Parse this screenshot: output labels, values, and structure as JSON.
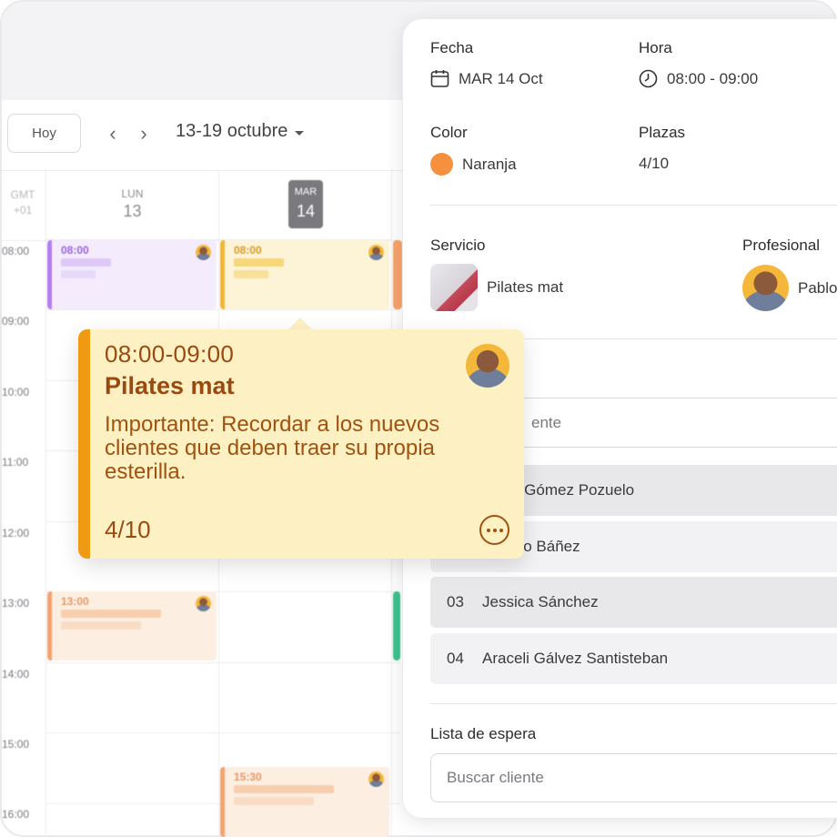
{
  "toolbar": {
    "today_label": "Hoy",
    "prev_icon": "chevron-left-icon",
    "next_icon": "chevron-right-icon",
    "range_label": "13-19 octubre"
  },
  "calendar": {
    "timezone": [
      "GMT",
      "+01"
    ],
    "days": [
      {
        "name": "LUN",
        "number": "13"
      },
      {
        "name": "MAR",
        "number": "14"
      }
    ],
    "hours": [
      "08:00",
      "09:00",
      "10:00",
      "11:00",
      "12:00",
      "13:00",
      "14:00",
      "15:00",
      "16:00"
    ],
    "events": [
      {
        "time": "08:00",
        "color": "#c9a6f5"
      },
      {
        "time": "08:00",
        "color": "#f5c14a"
      },
      {
        "time": "13:00",
        "color": "#f6a36a"
      },
      {
        "time": "15:30",
        "color": "#f6a36a"
      }
    ]
  },
  "tooltip": {
    "time": "08:00-09:00",
    "title": "Pilates mat",
    "note": "Importante: Recordar a los nuevos clientes que deben traer su propia esterilla.",
    "seats": "4/10",
    "chat_icon": "chat-bubble-icon"
  },
  "panel": {
    "date_label": "Fecha",
    "date_value": "MAR 14 Oct",
    "time_label": "Hora",
    "time_value": "08:00 - 09:00",
    "color_label": "Color",
    "color_value": "Naranja",
    "color_hex": "#f5913e",
    "seats_label": "Plazas",
    "seats_value": "4/10",
    "service_label": "Servicio",
    "service_value": "Pilates mat",
    "professional_label": "Profesional",
    "professional_value": "Pablo",
    "client_search_placeholder": "ente",
    "attendees": [
      {
        "num": "",
        "name": "n Gómez Pozuelo"
      },
      {
        "num": "",
        "name": "alo Báñez"
      },
      {
        "num": "03",
        "name": "Jessica Sánchez"
      },
      {
        "num": "04",
        "name": "Araceli Gálvez Santisteban"
      }
    ],
    "waitlist_label": "Lista de espera",
    "waitlist_placeholder": "Buscar cliente"
  }
}
